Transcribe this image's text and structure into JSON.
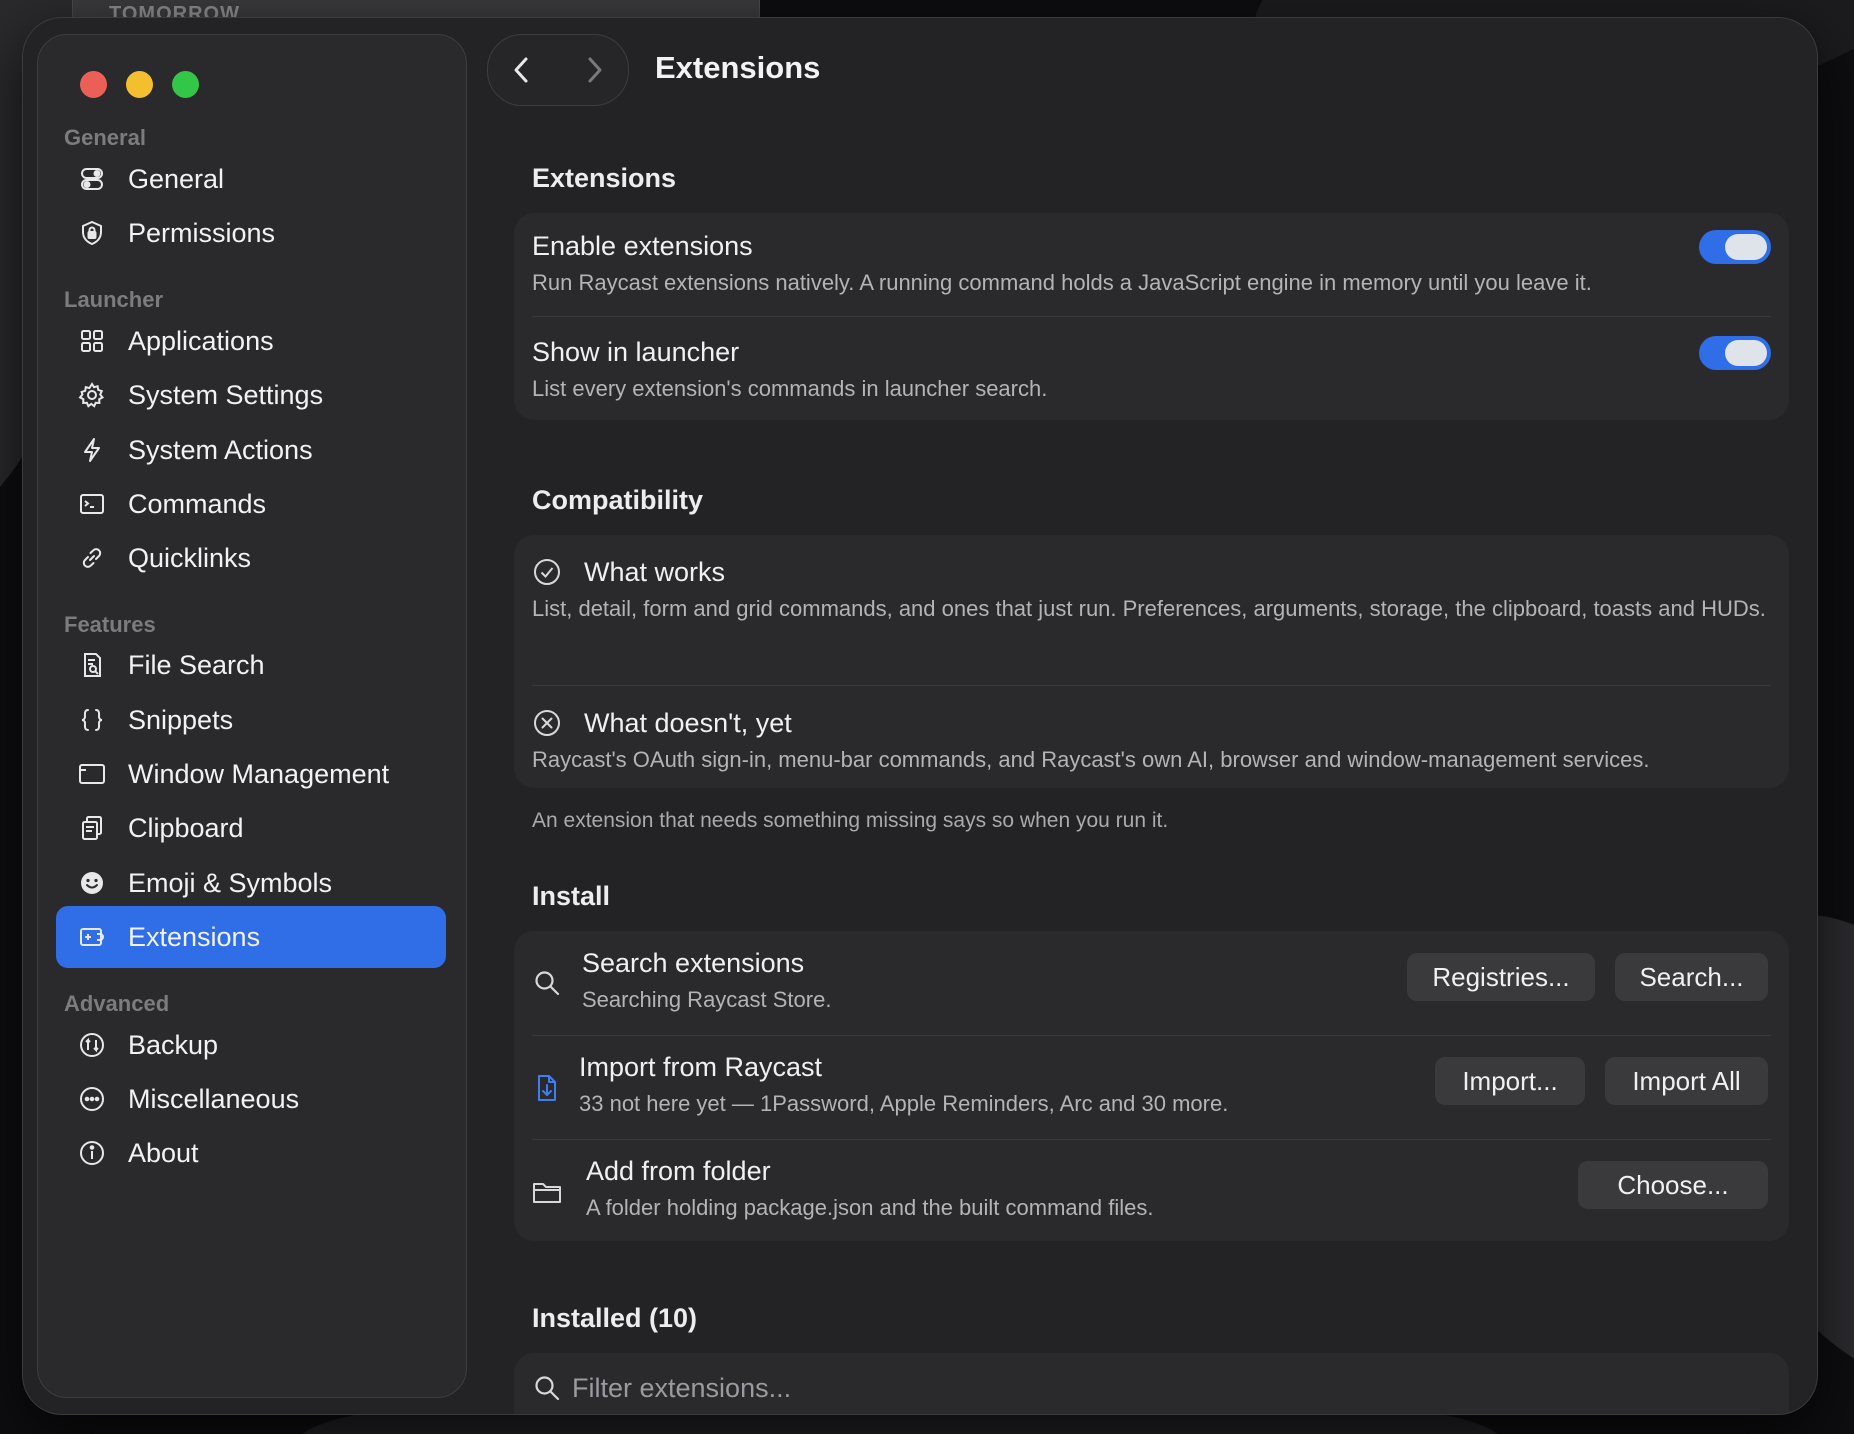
{
  "background": {
    "tab_text": "TOMORROW"
  },
  "colors": {
    "accent": "#2f6ee6",
    "window_bg": "#232325",
    "card_bg": "#2a2a2c",
    "close": "#ec5f57",
    "minimize": "#f4bf2f",
    "zoom": "#33c748"
  },
  "header": {
    "title": "Extensions"
  },
  "sidebar": {
    "sections": [
      {
        "label": "General",
        "items": [
          {
            "label": "General",
            "icon": "toggles-icon"
          },
          {
            "label": "Permissions",
            "icon": "shield-lock-icon"
          }
        ]
      },
      {
        "label": "Launcher",
        "items": [
          {
            "label": "Applications",
            "icon": "grid-icon"
          },
          {
            "label": "System Settings",
            "icon": "gear-icon"
          },
          {
            "label": "System Actions",
            "icon": "bolt-icon"
          },
          {
            "label": "Commands",
            "icon": "terminal-icon"
          },
          {
            "label": "Quicklinks",
            "icon": "link-icon"
          }
        ]
      },
      {
        "label": "Features",
        "items": [
          {
            "label": "File Search",
            "icon": "document-search-icon"
          },
          {
            "label": "Snippets",
            "icon": "braces-icon"
          },
          {
            "label": "Window Management",
            "icon": "window-icon"
          },
          {
            "label": "Clipboard",
            "icon": "clipboard-icon"
          },
          {
            "label": "Emoji & Symbols",
            "icon": "smiley-icon"
          },
          {
            "label": "Extensions",
            "icon": "extensions-icon",
            "active": true
          }
        ]
      },
      {
        "label": "Advanced",
        "items": [
          {
            "label": "Backup",
            "icon": "backup-icon"
          },
          {
            "label": "Miscellaneous",
            "icon": "ellipsis-circle-icon"
          },
          {
            "label": "About",
            "icon": "info-icon"
          }
        ]
      }
    ]
  },
  "extensions_section": {
    "heading": "Extensions",
    "enable": {
      "title": "Enable extensions",
      "subtitle": "Run Raycast extensions natively. A running command holds a JavaScript engine in memory until you leave it.",
      "on": true
    },
    "show_in_launcher": {
      "title": "Show in launcher",
      "subtitle": "List every extension's commands in launcher search.",
      "on": true
    }
  },
  "compatibility": {
    "heading": "Compatibility",
    "works": {
      "title": "What works",
      "subtitle": "List, detail, form and grid commands, and ones that just run. Preferences, arguments, storage, the clipboard, toasts and HUDs."
    },
    "doesnt": {
      "title": "What doesn't, yet",
      "subtitle": "Raycast's OAuth sign-in, menu-bar commands, and Raycast's own AI, browser and window-management services."
    },
    "note": "An extension that needs something missing says so when you run it."
  },
  "install": {
    "heading": "Install",
    "search": {
      "title": "Search extensions",
      "subtitle": "Searching Raycast Store.",
      "btn_registries": "Registries...",
      "btn_search": "Search..."
    },
    "import": {
      "title": "Import from Raycast",
      "subtitle": "33 not here yet — 1Password, Apple Reminders, Arc and 30 more.",
      "btn_import": "Import...",
      "btn_import_all": "Import All"
    },
    "folder": {
      "title": "Add from folder",
      "subtitle": "A folder holding package.json and the built command files.",
      "btn_choose": "Choose..."
    }
  },
  "installed": {
    "heading": "Installed (10)",
    "filter_placeholder": "Filter extensions..."
  }
}
